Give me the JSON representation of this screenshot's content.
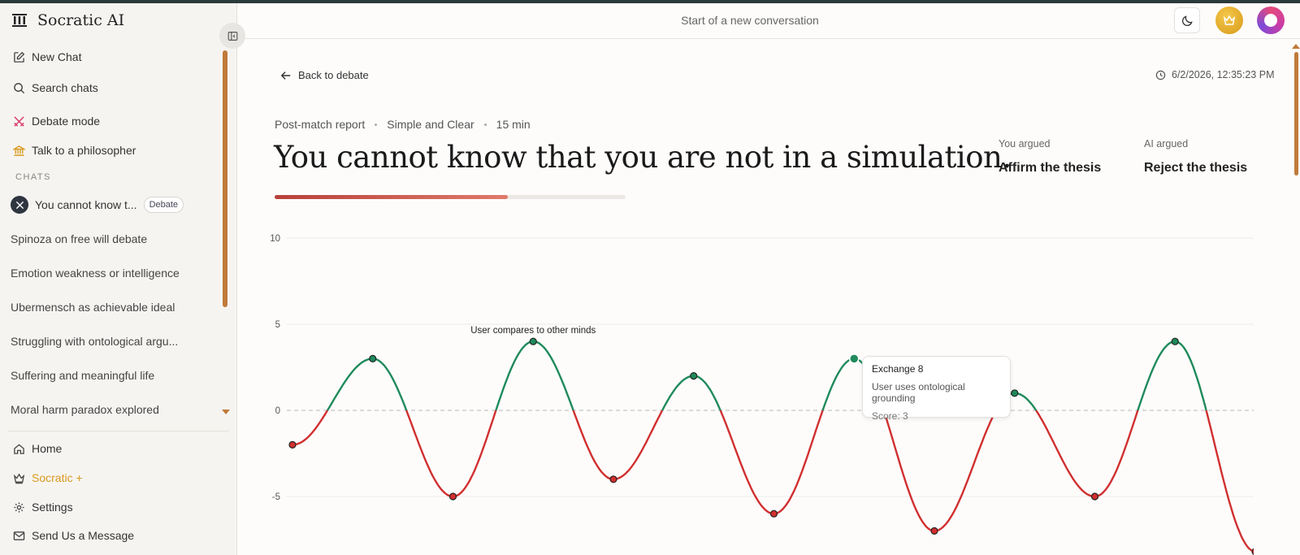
{
  "app": {
    "name": "Socratic AI"
  },
  "sidebar": {
    "nav_top": [
      {
        "label": "New Chat",
        "icon": "edit-icon"
      },
      {
        "label": "Search chats",
        "icon": "search-icon"
      },
      {
        "label": "Debate mode",
        "icon": "swords-icon"
      },
      {
        "label": "Talk to a philosopher",
        "icon": "bank-icon"
      }
    ],
    "section_label": "CHATS",
    "active_chat": {
      "title": "You cannot know t...",
      "badge": "Debate"
    },
    "chats": [
      "Spinoza on free will debate",
      "Emotion weakness or intelligence",
      "Ubermensch as achievable ideal",
      "Struggling with ontological argu...",
      "Suffering and meaningful life",
      "Moral harm paradox explored"
    ],
    "nav_bottom": [
      {
        "label": "Home",
        "icon": "home-icon"
      },
      {
        "label": "Socratic +",
        "icon": "crown-icon"
      },
      {
        "label": "Settings",
        "icon": "gear-icon"
      },
      {
        "label": "Send Us a Message",
        "icon": "mail-icon"
      }
    ]
  },
  "header": {
    "title": "Start of a new conversation"
  },
  "report": {
    "back_label": "Back to debate",
    "timestamp": "6/2/2026, 12:35:23 PM",
    "meta": [
      "Post-match report",
      "Simple and Clear",
      "15 min"
    ],
    "thesis": "You cannot know that you are not in a simulation.",
    "progress": 0.665,
    "you_argued_label": "You argued",
    "you_argued_value": "Affirm the thesis",
    "ai_argued_label": "AI argued",
    "ai_argued_value": "Reject the thesis"
  },
  "colors": {
    "positive": "#1f8a5b",
    "negative": "#d12f2f",
    "accent": "#c07a3a",
    "premium": "#d99a1e"
  },
  "chart_data": {
    "type": "line",
    "ylim": [
      -8,
      10
    ],
    "yticks": [
      10,
      5,
      0,
      -5
    ],
    "x": [
      1,
      2,
      3,
      4,
      5,
      6,
      7,
      8,
      9,
      10,
      11,
      12,
      13,
      14
    ],
    "values": [
      -2,
      3,
      -5,
      4,
      -4,
      2,
      -6,
      3,
      -7,
      1,
      -5,
      4,
      -8.2
    ],
    "annotations": [
      {
        "x": 4,
        "text": "User compares to other minds"
      }
    ],
    "tooltip": {
      "title": "Exchange 8",
      "text": "User uses ontological grounding",
      "score": "Score: 3"
    }
  }
}
